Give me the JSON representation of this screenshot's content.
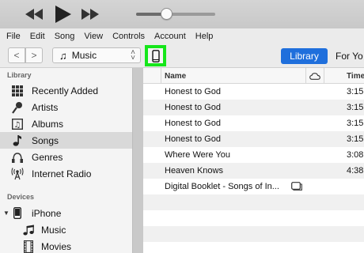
{
  "menu": [
    "File",
    "Edit",
    "Song",
    "View",
    "Controls",
    "Account",
    "Help"
  ],
  "player": {
    "volume_level": 0.38
  },
  "toolbar": {
    "back_label": "<",
    "forward_label": ">",
    "media_type": "Music",
    "tab_library": "Library",
    "tab_for_you": "For Yo"
  },
  "sidebar": {
    "library_header": "Library",
    "library_items": [
      {
        "label": "Recently Added",
        "icon": "grid-icon"
      },
      {
        "label": "Artists",
        "icon": "microphone-icon"
      },
      {
        "label": "Albums",
        "icon": "album-icon"
      },
      {
        "label": "Songs",
        "icon": "music-note-icon",
        "selected": true
      },
      {
        "label": "Genres",
        "icon": "genres-icon"
      },
      {
        "label": "Internet Radio",
        "icon": "antenna-icon"
      }
    ],
    "devices_header": "Devices",
    "device": {
      "label": "iPhone",
      "icon": "iphone-icon"
    },
    "device_items": [
      {
        "label": "Music",
        "icon": "music-note-icon"
      },
      {
        "label": "Movies",
        "icon": "film-icon"
      }
    ]
  },
  "table": {
    "col_name": "Name",
    "col_time": "Time",
    "rows": [
      {
        "name": "Honest to God",
        "time": "3:15"
      },
      {
        "name": "Honest to God",
        "time": "3:15"
      },
      {
        "name": "Honest to God",
        "time": "3:15"
      },
      {
        "name": "Honest to God",
        "time": "3:15"
      },
      {
        "name": "Where Were You",
        "time": "3:08"
      },
      {
        "name": "Heaven Knows",
        "time": "4:38"
      },
      {
        "name": "Digital Booklet - Songs of In...",
        "time": "",
        "badge": true
      }
    ]
  }
}
